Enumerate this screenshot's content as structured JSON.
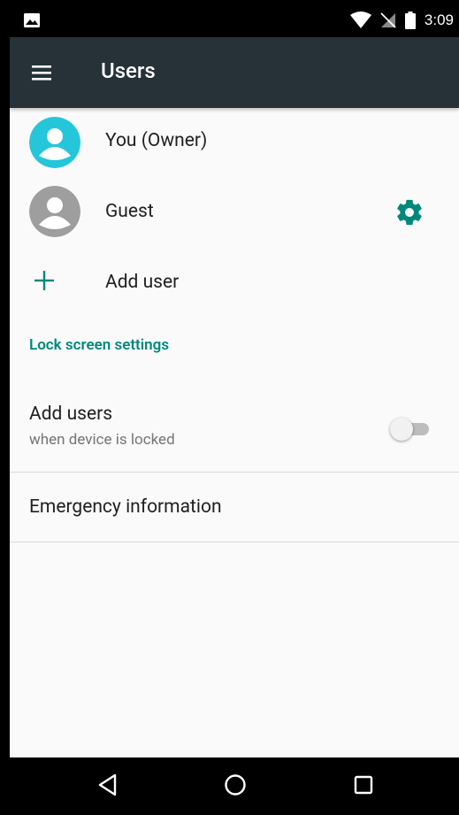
{
  "status_bar": {
    "time": "3:09",
    "left_icon": "image-notification-icon",
    "icons": [
      "wifi-icon",
      "no-sim-icon",
      "battery-icon"
    ]
  },
  "app_bar": {
    "title": "Users",
    "menu_icon": "menu-icon"
  },
  "users": [
    {
      "name": "You (Owner)",
      "avatar_color": "#26c6da",
      "icon": "account-icon"
    },
    {
      "name": "Guest",
      "avatar_color": "#9e9e9e",
      "icon": "account-icon",
      "settings_icon": "gear-icon"
    }
  ],
  "add_user": {
    "label": "Add user",
    "icon": "plus-icon"
  },
  "lock_screen": {
    "header": "Lock screen settings",
    "add_users_title": "Add users",
    "add_users_summary": "when device is locked",
    "add_users_enabled": false
  },
  "emergency": {
    "label": "Emergency information"
  },
  "colors": {
    "accent": "#00897b",
    "app_bar": "#263238",
    "owner_avatar": "#26c6da",
    "guest_avatar": "#9e9e9e"
  },
  "nav_bar": {
    "buttons": [
      "back-icon",
      "home-icon",
      "recents-icon"
    ]
  }
}
